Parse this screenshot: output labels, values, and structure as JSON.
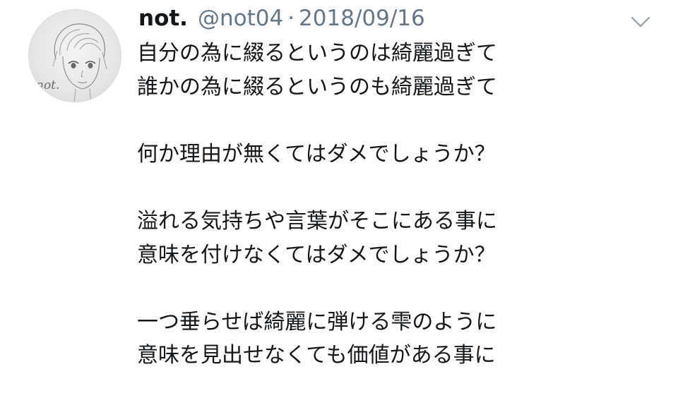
{
  "tweet": {
    "display_name": "not.",
    "handle": "@not04",
    "separator": "·",
    "date": "2018/09/16",
    "avatar_text": "not.",
    "lines": [
      "自分の為に綴るというのは綺麗過ぎて",
      "誰かの為に綴るというのも綺麗過ぎて",
      "",
      "何か理由が無くてはダメでしょうか？",
      "",
      "溢れる気持ちや言葉がそこにある事に",
      "意味を付けなくてはダメでしょうか？",
      "",
      "一つ垂らせば綺麗に弾ける雫のように",
      "意味を見出せなくても価値がある事に"
    ]
  },
  "icons": {
    "menu": "chevron-down-icon"
  },
  "colors": {
    "text": "#14171a",
    "secondary": "#657786",
    "caret": "#9aa7b2"
  }
}
